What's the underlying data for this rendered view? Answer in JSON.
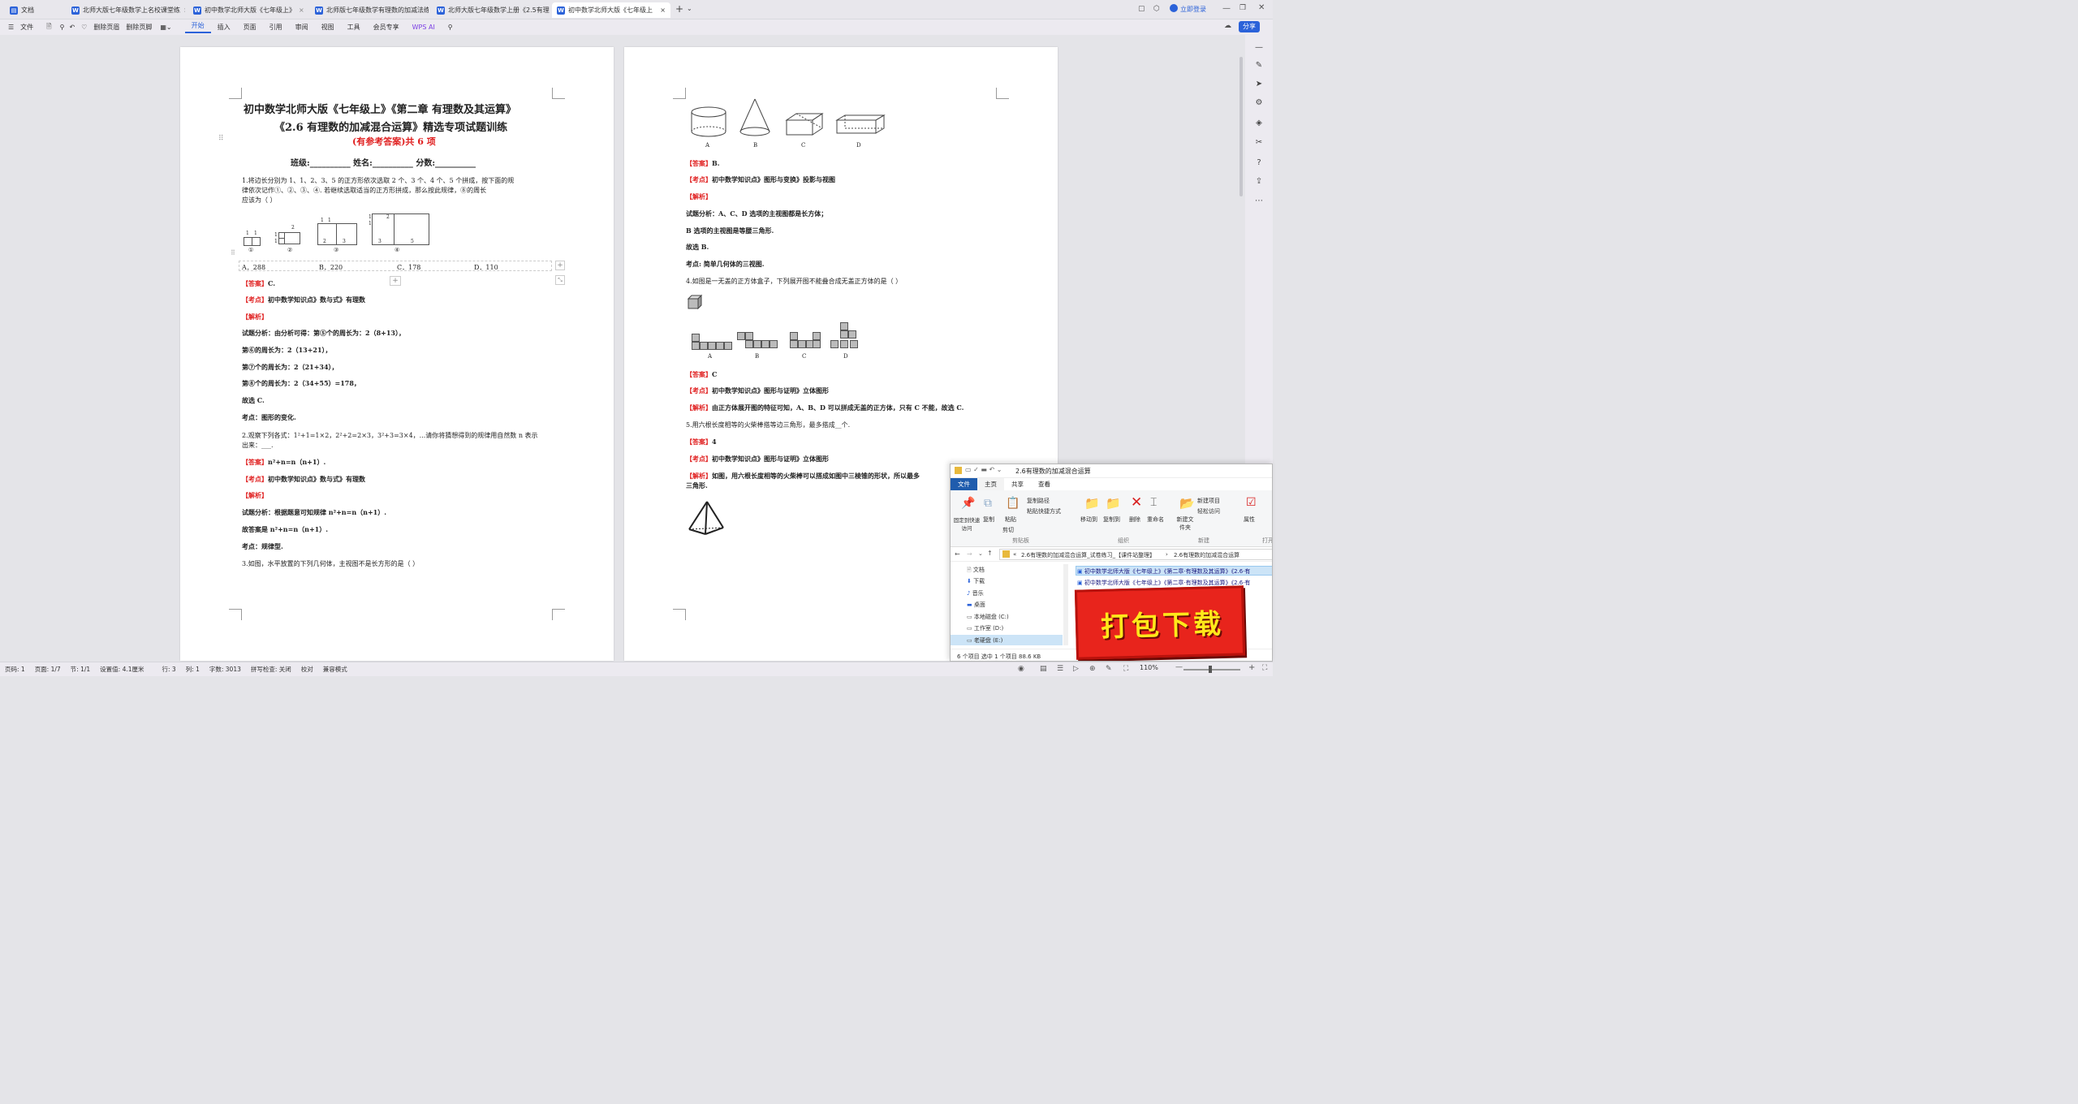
{
  "tabs": [
    {
      "label": "文档",
      "kind": "home"
    },
    {
      "label": "北师大版七年级数学上名校课堂练",
      "kind": "doc"
    },
    {
      "label": "初中数学北师大版《七年级上》",
      "kind": "doc"
    },
    {
      "label": "北师版七年级数学有理数的加减法练习",
      "kind": "doc"
    },
    {
      "label": "北师大版七年级数学上册《2.5有理",
      "kind": "doc"
    },
    {
      "label": "初中数学北师大版《七年级上",
      "kind": "doc",
      "active": true
    }
  ],
  "login": "立即登录",
  "ribbon": {
    "file": "文件",
    "items": [
      "删除页眉",
      "删除页脚"
    ],
    "menus": [
      "开始",
      "插入",
      "页面",
      "引用",
      "审阅",
      "视图",
      "工具",
      "会员专享"
    ],
    "wps_ai": "WPS AI",
    "share": "分享"
  },
  "doc": {
    "title1": "初中数学北师大版《七年级上》《第二章 有理数及其运算》",
    "title2": "《2.6 有理数的加减混合运算》精选专项试题训练",
    "title3": "(有参考答案)共 6 项",
    "fields": "班级:__________   姓名:__________   分数:__________",
    "q1": [
      "1.将边长分别为 1、1、2、3、5 的正方形依次选取 2 个、3 个、4 个、5 个拼成，按下面的规",
      "律依次记作①、②、③、④. 若继续选取适当的正方形拼成，那么按此规律，⑧的周长",
      "应该为（        ）"
    ],
    "q1_fig_labels": [
      "①",
      "②",
      "③",
      "④"
    ],
    "q1_opts": [
      "A．288",
      "B．220",
      "C．178",
      "D．110"
    ],
    "q1_answer_label": "【答案】",
    "q1_answer": "C.",
    "kaodian_label": "【考点】",
    "q1_kaodian": "初中数学知识点》数与式》有理数",
    "jiexi_label": "【解析】",
    "q1_ana": [
      "试题分析：由分析可得：第⑤个的周长为：2（8+13），",
      "第⑥的周长为：2（13+21），",
      "第⑦个的周长为：2（21+34），",
      "第⑧个的周长为：2（34+55）=178，",
      "故选 C.",
      "考点：图形的变化."
    ],
    "q2": [
      "2.观察下列各式：1²+1=1×2，2²+2=2×3，3²+3=3×4，...请你将猜想得到的规律用自然数 n 表示",
      "出来：___."
    ],
    "q2_answer": "n²+n=n（n+1）.",
    "q2_kaodian": "初中数学知识点》数与式》有理数",
    "q2_ana": [
      "试题分析：根据题意可知规律 n²+n=n（n+1）.",
      "故答案是 n²+n=n（n+1）.",
      "考点：规律型."
    ],
    "q3": "3.如图，水平放置的下列几何体，主视图不是长方形的是（        ）",
    "q3_fig_labels": [
      "A",
      "B",
      "C",
      "D"
    ],
    "q3_answer": "B.",
    "q3_kaodian": "初中数学知识点》图形与变换》投影与视图",
    "q3_ana": [
      "试题分析：A、C、D 选项的主视图都是长方体；",
      "B 选项的主视图是等腰三角形.",
      "故选 B.",
      "考点: 简单几何体的三视图."
    ],
    "q4": "4.如图是一无盖的正方体盒子，下列展开图不能叠合成无盖正方体的是（        ）",
    "q4_fig_labels": [
      "A",
      "B",
      "C",
      "D"
    ],
    "q4_answer": "C",
    "q4_kaodian": "初中数学知识点》图形与证明》立体图形",
    "q4_ana": "由正方体展开图的特征可知，A、B、D 可以拼成无盖的正方体，只有 C 不能，故选 C.",
    "q5": "5.用六根长度相等的火柴棒搭等边三角形，最多搭成__个.",
    "q5_answer": "4",
    "q5_kaodian": "初中数学知识点》图形与证明》立体图形",
    "q5_ana": [
      "如图，用六根长度相等的火柴棒可以搭成如图中三棱锥的形状，所以最多",
      "三角形."
    ],
    "fig_nums": {
      "n1": [
        "1",
        "1"
      ],
      "n2": [
        "1",
        "1",
        "2"
      ],
      "n3": [
        "1",
        "1",
        "2",
        "3"
      ],
      "n4": [
        "1",
        "1",
        "2",
        "3",
        "5"
      ]
    }
  },
  "explorer": {
    "title": "2.6有理数的加减混合运算",
    "tabs": [
      "文件",
      "主页",
      "共享",
      "查看"
    ],
    "ribbon_btns": [
      "固定到快速访问",
      "复制",
      "粘贴",
      "复制路径",
      "粘贴快捷方式",
      "剪切",
      "移动到",
      "复制到",
      "删除",
      "重命名",
      "新建文件夹",
      "新建项目",
      "轻松访问",
      "属性",
      "打开"
    ],
    "group_labels": [
      "剪贴板",
      "组织",
      "新建",
      "打开"
    ],
    "path": [
      "2.6有理数的加减混合运算_试卷练习_【课件站整理】",
      "2.6有理数的加减混合运算"
    ],
    "nav": [
      "文档",
      "下载",
      "音乐",
      "桌面",
      "本地磁盘 (C:)",
      "工作室 (D:)",
      "老硬盘 (E:)"
    ],
    "files": [
      "初中数学北师大版《七年级上》《第二章·有理数及其运算》《2.6·有",
      "初中数学北师大版《七年级上》《第二章·有理数及其运算》《2.6·有"
    ],
    "status": "6 个项目    选中 1 个项目  88.6 KB",
    "banner": "打包下载"
  },
  "status": {
    "page": "页码: 1",
    "pages": "页面: 1/7",
    "section": "节: 1/1",
    "setting": "设置值: 4.1厘米",
    "row": "行: 3",
    "col": "列: 1",
    "words": "字数: 3013",
    "spell": "拼写检查: 关闭",
    "proof": "校对",
    "compat": "兼容模式",
    "zoom": "110%"
  }
}
